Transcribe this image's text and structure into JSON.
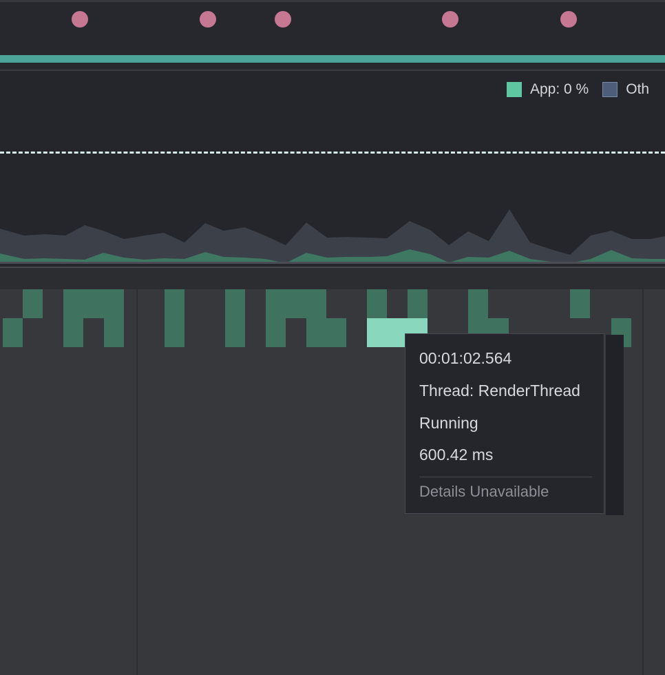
{
  "colors": {
    "event_dot": "#c67892",
    "lifecycle": "#4ca397",
    "app_cpu": "#5fc6a2",
    "other_cpu": "#4d5e7b",
    "thread_running": "#3f7360",
    "thread_running_selected": "#89d8bd"
  },
  "cpu_legend": {
    "app_label": "App: 0 %",
    "other_label": "Oth"
  },
  "tooltip": {
    "timestamp": "00:01:02.564",
    "thread": "Thread: RenderThread",
    "state": "Running",
    "duration": "600.42 ms",
    "details": "Details Unavailable"
  }
}
